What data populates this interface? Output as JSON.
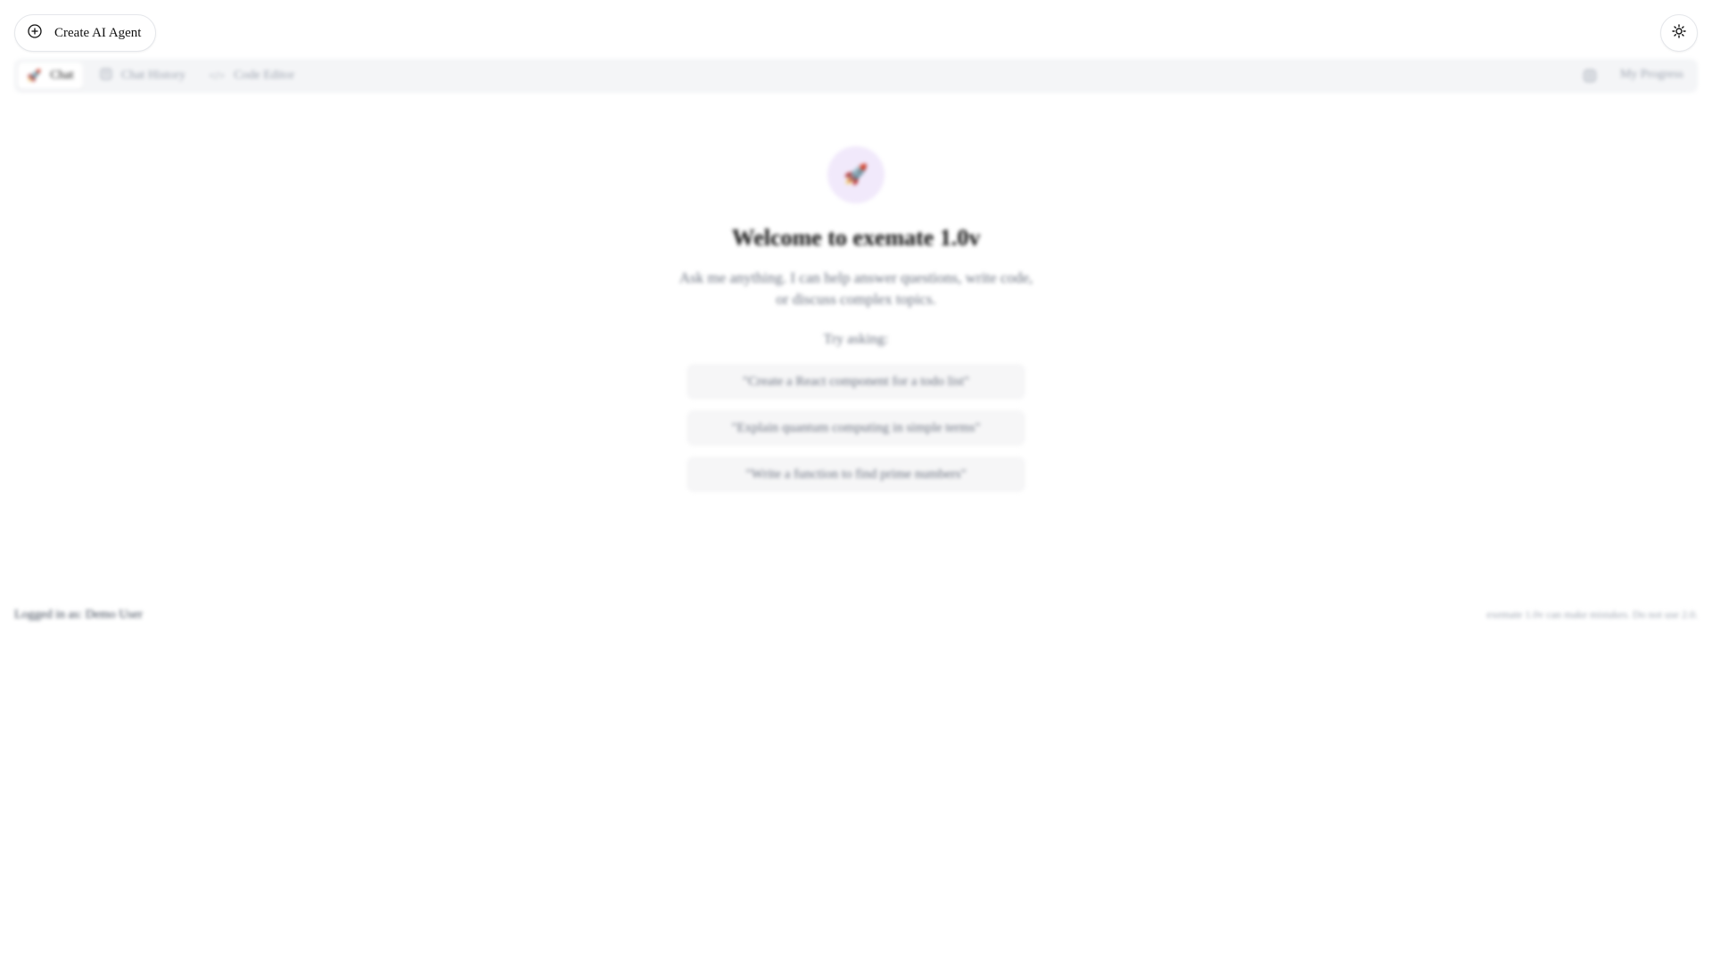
{
  "header": {
    "create_button_label": "Create AI Agent",
    "create_icon": "plus-circle-icon",
    "theme_icon": "sun-icon"
  },
  "tabs": [
    {
      "label": "Chat",
      "icon": "rocket-icon",
      "active": true
    },
    {
      "label": "Chat History",
      "icon": "history-icon",
      "active": false
    },
    {
      "label": "Code Editor",
      "icon": "code-icon",
      "active": false
    }
  ],
  "tabbar_right": {
    "icon": "settings-icon",
    "label": "My Progress"
  },
  "welcome": {
    "avatar_icon": "rocket-icon",
    "title": "Welcome to exemate 1.0v",
    "subtitle": "Ask me anything. I can help answer questions, write code, or discuss complex topics.",
    "try_label": "Try asking:",
    "suggestions": [
      "\"Create a React component for a todo list\"",
      "\"Explain quantum computing in simple terms\"",
      "\"Write a function to find prime numbers\""
    ]
  },
  "footer": {
    "left": "Logged in as: Demo User",
    "right": "exemate 1.0v can make mistakes. Do not use 2.0."
  },
  "colors": {
    "accent_avatar_bg": "#f1e9fb",
    "tabbar_bg": "#f4f5f7",
    "suggestion_bg": "#f6f6f7"
  }
}
